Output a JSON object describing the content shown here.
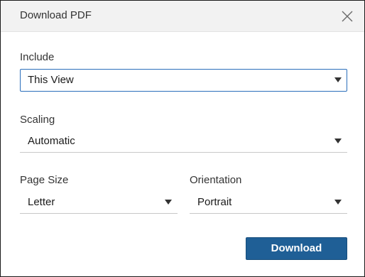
{
  "dialog": {
    "title": "Download PDF",
    "close_icon": "close-icon"
  },
  "include": {
    "label": "Include",
    "value": "This View"
  },
  "scaling": {
    "label": "Scaling",
    "value": "Automatic"
  },
  "page_size": {
    "label": "Page Size",
    "value": "Letter"
  },
  "orientation": {
    "label": "Orientation",
    "value": "Portrait"
  },
  "actions": {
    "download_label": "Download"
  },
  "colors": {
    "primary_button": "#1f5f96",
    "focus_border": "#2a6ebb",
    "titlebar_bg": "#f2f2f2"
  },
  "icons": {
    "dropdown": "caret-down-icon",
    "close": "close-icon"
  }
}
